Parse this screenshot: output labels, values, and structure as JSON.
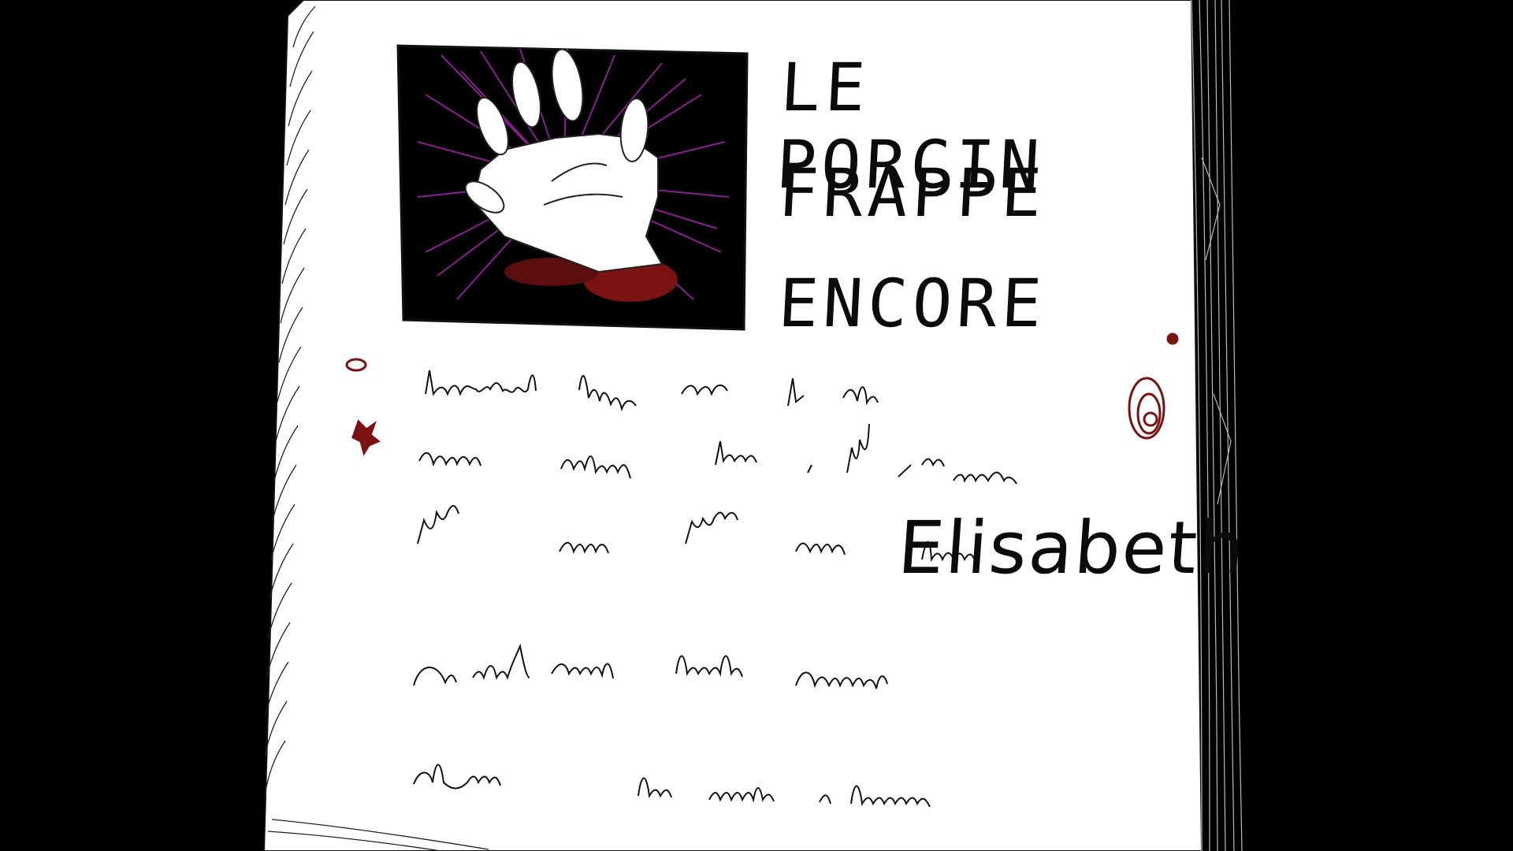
{
  "newspaper": {
    "headline": [
      "LE PORCIN",
      "FRAPPE",
      "ENCORE"
    ],
    "highlighted_name": "Elisabeth",
    "illustration": "hand-icon"
  },
  "colors": {
    "background": "#000000",
    "page": "#ffffff",
    "ink": "#0b0b0b",
    "rays": "#8a1f8f",
    "blood": "#7a1212"
  }
}
